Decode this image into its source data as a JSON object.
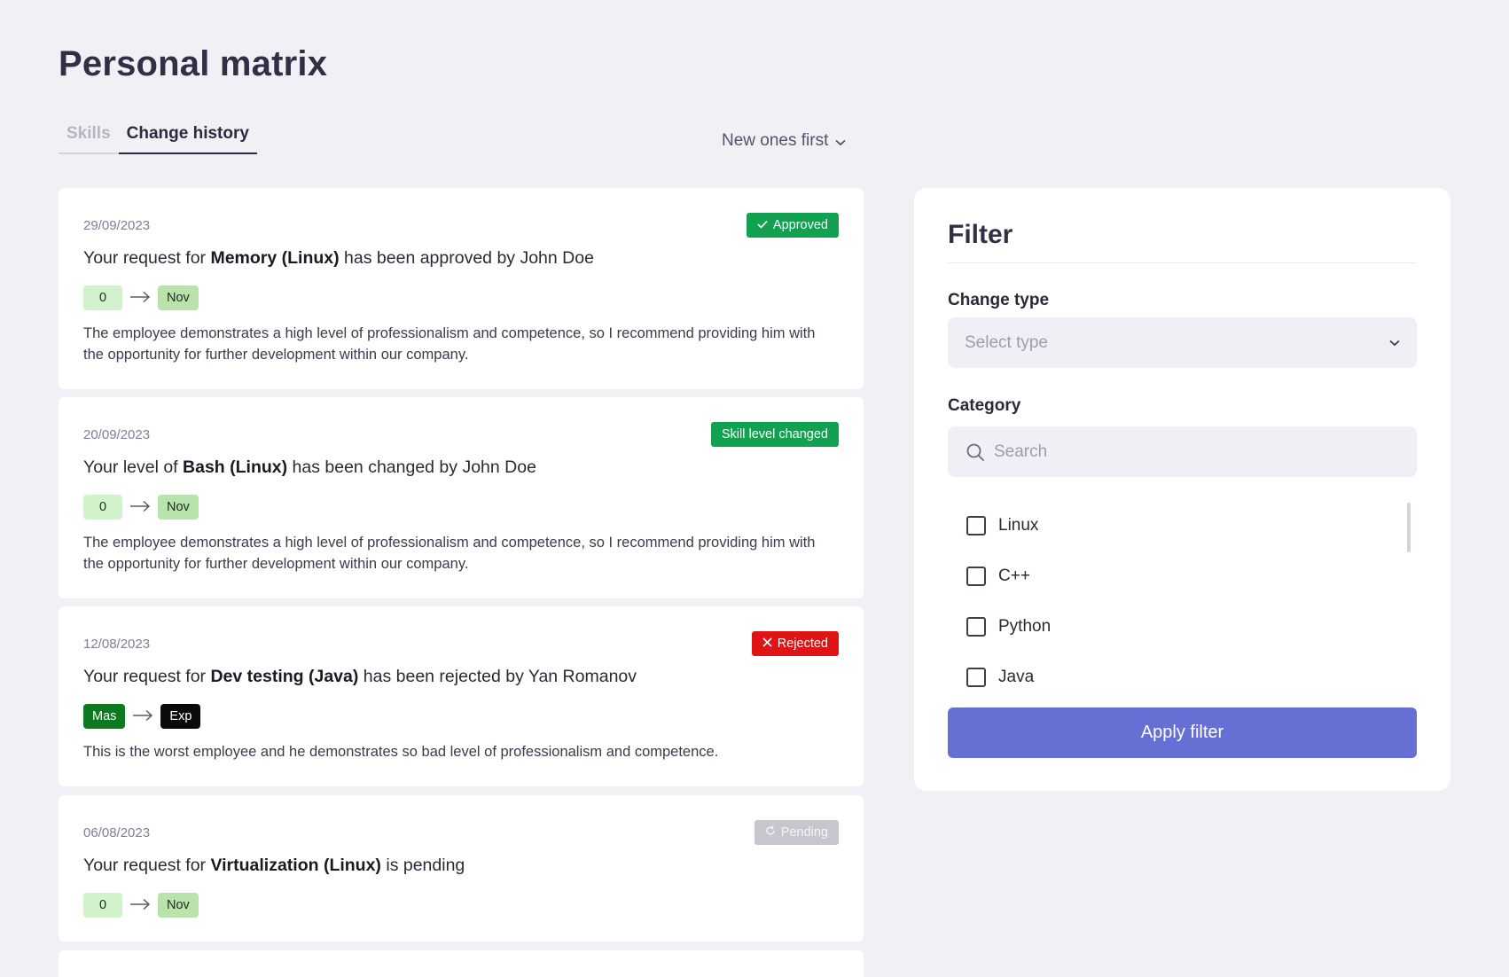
{
  "page": {
    "title": "Personal matrix"
  },
  "tabs": [
    {
      "label": "Skills",
      "active": false
    },
    {
      "label": "Change history",
      "active": true
    }
  ],
  "sort": {
    "label": "New ones first"
  },
  "feed": [
    {
      "date": "29/09/2023",
      "badge": {
        "label": "Approved",
        "icon": "check-icon",
        "status": "approved",
        "color": "#12a150"
      },
      "msg_prefix": "Your request for ",
      "msg_skill": "Memory (Linux)",
      "msg_suffix": " has been approved by John Doe",
      "from_level": "0",
      "to_level": "Nov",
      "comment": "The employee demonstrates a high level of professionalism and competence, so I recommend providing him with the opportunity for further development within our company."
    },
    {
      "date": "20/09/2023",
      "badge": {
        "label": "Skill level changed",
        "icon": "",
        "status": "changed",
        "color": "#12a150"
      },
      "msg_prefix": "Your level of ",
      "msg_skill": "Bash (Linux)",
      "msg_suffix": " has been changed by John Doe",
      "from_level": "0",
      "to_level": "Nov",
      "comment": "The employee demonstrates a high level of professionalism and competence, so I recommend providing him with the opportunity for further development within our company."
    },
    {
      "date": "12/08/2023",
      "badge": {
        "label": "Rejected",
        "icon": "close-icon",
        "status": "rejected",
        "color": "#e01414"
      },
      "msg_prefix": "Your request for ",
      "msg_skill": "Dev testing (Java)",
      "msg_suffix": " has been rejected by Yan Romanov",
      "from_level": "Mas",
      "to_level": "Exp",
      "comment": "This is the worst employee and he demonstrates so bad level of professionalism and competence."
    },
    {
      "date": "06/08/2023",
      "badge": {
        "label": "Pending",
        "icon": "refresh-icon",
        "status": "pending",
        "color": "#c7c6cf"
      },
      "msg_prefix": "Your request for ",
      "msg_skill": "Virtualization (Linux)",
      "msg_suffix": " is pending",
      "from_level": "0",
      "to_level": "Nov",
      "comment": ""
    }
  ],
  "filter": {
    "title": "Filter",
    "change_type": {
      "label": "Change type",
      "placeholder": "Select type"
    },
    "category": {
      "label": "Category",
      "search_placeholder": "Search",
      "items": [
        "Linux",
        "C++",
        "Python",
        "Java"
      ]
    },
    "apply_label": "Apply filter"
  },
  "colors": {
    "accent": "#6670d4",
    "approved": "#12a150",
    "rejected": "#e01414",
    "pending": "#c7c6cf"
  }
}
